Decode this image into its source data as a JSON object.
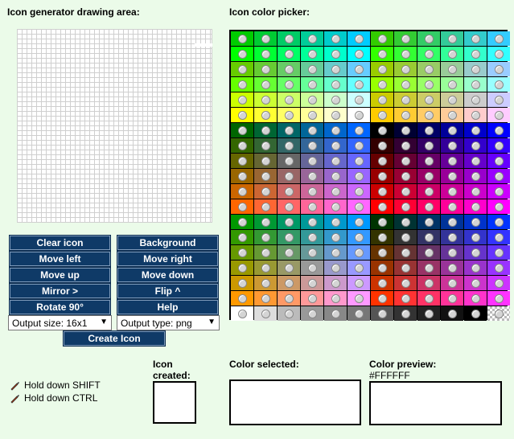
{
  "headings": {
    "drawing_area": "Icon generator drawing area:",
    "color_picker": "Icon color picker:"
  },
  "buttons": {
    "clear_icon": "Clear icon",
    "background": "Background",
    "move_left": "Move left",
    "move_right": "Move right",
    "move_up": "Move up",
    "move_down": "Move down",
    "mirror": "Mirror >",
    "flip": "Flip ^",
    "rotate": "Rotate 90°",
    "help": "Help",
    "create_icon": "Create Icon"
  },
  "selects": {
    "output_size": "Output size: 16x1",
    "output_type": "Output type: png"
  },
  "hints": {
    "shift": "Hold down SHIFT",
    "ctrl": "Hold down CTRL"
  },
  "labels": {
    "icon_created_line1": "Icon",
    "icon_created_line2": "created:",
    "color_selected": "Color selected:",
    "color_preview": "Color preview:",
    "color_preview_value": "#FFFFFF"
  },
  "palette": {
    "rows": [
      [
        "#00cc00",
        "#00cc33",
        "#00cc66",
        "#00cc99",
        "#00cccc",
        "#00ccff",
        "#33cc00",
        "#33cc33",
        "#33cc66",
        "#33cc99",
        "#33cccc",
        "#33ccff"
      ],
      [
        "#00ff00",
        "#00ff33",
        "#00ff66",
        "#00ff99",
        "#00ffcc",
        "#00ffff",
        "#33ff00",
        "#33ff33",
        "#33ff66",
        "#33ff99",
        "#33ffcc",
        "#33ffff"
      ],
      [
        "#66cc00",
        "#66cc33",
        "#66cc66",
        "#66cc99",
        "#66cccc",
        "#66ccff",
        "#99cc00",
        "#99cc33",
        "#99cc66",
        "#99cc99",
        "#99cccc",
        "#99ccff"
      ],
      [
        "#66ff00",
        "#66ff33",
        "#66ff66",
        "#66ff99",
        "#66ffcc",
        "#66ffff",
        "#99ff00",
        "#99ff33",
        "#99ff66",
        "#99ff99",
        "#99ffcc",
        "#99ffff"
      ],
      [
        "#ccff00",
        "#ccff33",
        "#ccff66",
        "#ccff99",
        "#ccffcc",
        "#ccffff",
        "#cccc00",
        "#cccc33",
        "#cccc66",
        "#cccc99",
        "#cccccc",
        "#ccccff"
      ],
      [
        "#ffff00",
        "#ffff33",
        "#ffff66",
        "#ffff99",
        "#ffffcc",
        "#ffffff",
        "#ffcc00",
        "#ffcc33",
        "#ffcc66",
        "#ffcc99",
        "#ffcccc",
        "#ffccff"
      ],
      [
        "#006600",
        "#006633",
        "#006666",
        "#006699",
        "#0066cc",
        "#0066ff",
        "#000000",
        "#000033",
        "#000066",
        "#000099",
        "#0000cc",
        "#0000ff"
      ],
      [
        "#336600",
        "#336633",
        "#336666",
        "#336699",
        "#3366cc",
        "#3366ff",
        "#330000",
        "#330033",
        "#330066",
        "#330099",
        "#3300cc",
        "#3300ff"
      ],
      [
        "#666600",
        "#666633",
        "#666666",
        "#666699",
        "#6666cc",
        "#6666ff",
        "#660000",
        "#660033",
        "#660066",
        "#660099",
        "#6600cc",
        "#6600ff"
      ],
      [
        "#996600",
        "#996633",
        "#996666",
        "#996699",
        "#9966cc",
        "#9966ff",
        "#990000",
        "#990033",
        "#990066",
        "#990099",
        "#9900cc",
        "#9900ff"
      ],
      [
        "#cc6600",
        "#cc6633",
        "#cc6666",
        "#cc6699",
        "#cc66cc",
        "#cc66ff",
        "#cc0000",
        "#cc0033",
        "#cc0066",
        "#cc0099",
        "#cc00cc",
        "#cc00ff"
      ],
      [
        "#ff6600",
        "#ff6633",
        "#ff6666",
        "#ff6699",
        "#ff66cc",
        "#ff66ff",
        "#ff0000",
        "#ff0033",
        "#ff0066",
        "#ff0099",
        "#ff00cc",
        "#ff00ff"
      ],
      [
        "#009900",
        "#009933",
        "#009966",
        "#009999",
        "#0099cc",
        "#0099ff",
        "#003300",
        "#003333",
        "#003366",
        "#003399",
        "#0033cc",
        "#0033ff"
      ],
      [
        "#339900",
        "#339933",
        "#339966",
        "#339999",
        "#3399cc",
        "#3399ff",
        "#333300",
        "#333333",
        "#333366",
        "#333399",
        "#3333cc",
        "#3333ff"
      ],
      [
        "#669900",
        "#669933",
        "#669966",
        "#669999",
        "#6699cc",
        "#6699ff",
        "#663300",
        "#663333",
        "#663366",
        "#663399",
        "#6633cc",
        "#6633ff"
      ],
      [
        "#999900",
        "#999933",
        "#999966",
        "#999999",
        "#9999cc",
        "#9999ff",
        "#993300",
        "#993333",
        "#993366",
        "#993399",
        "#9933cc",
        "#9933ff"
      ],
      [
        "#cc9900",
        "#cc9933",
        "#cc9966",
        "#cc9999",
        "#cc99cc",
        "#cc99ff",
        "#cc3300",
        "#cc3333",
        "#cc3366",
        "#cc3399",
        "#cc33cc",
        "#cc33ff"
      ],
      [
        "#ff9900",
        "#ff9933",
        "#ff9966",
        "#ff9999",
        "#ff99cc",
        "#ff99ff",
        "#ff3300",
        "#ff3333",
        "#ff3366",
        "#ff3399",
        "#ff33cc",
        "#ff33ff"
      ],
      [
        "#ffffff",
        "#dddddd",
        "#bbbbbb",
        "#999999",
        "#888888",
        "#777777",
        "#555555",
        "#333333",
        "#222222",
        "#111111",
        "#000000",
        "checker"
      ]
    ]
  },
  "colors": {
    "background": "#ebfbe9",
    "button": "#0f3a67",
    "button_text": "#ffffff"
  }
}
